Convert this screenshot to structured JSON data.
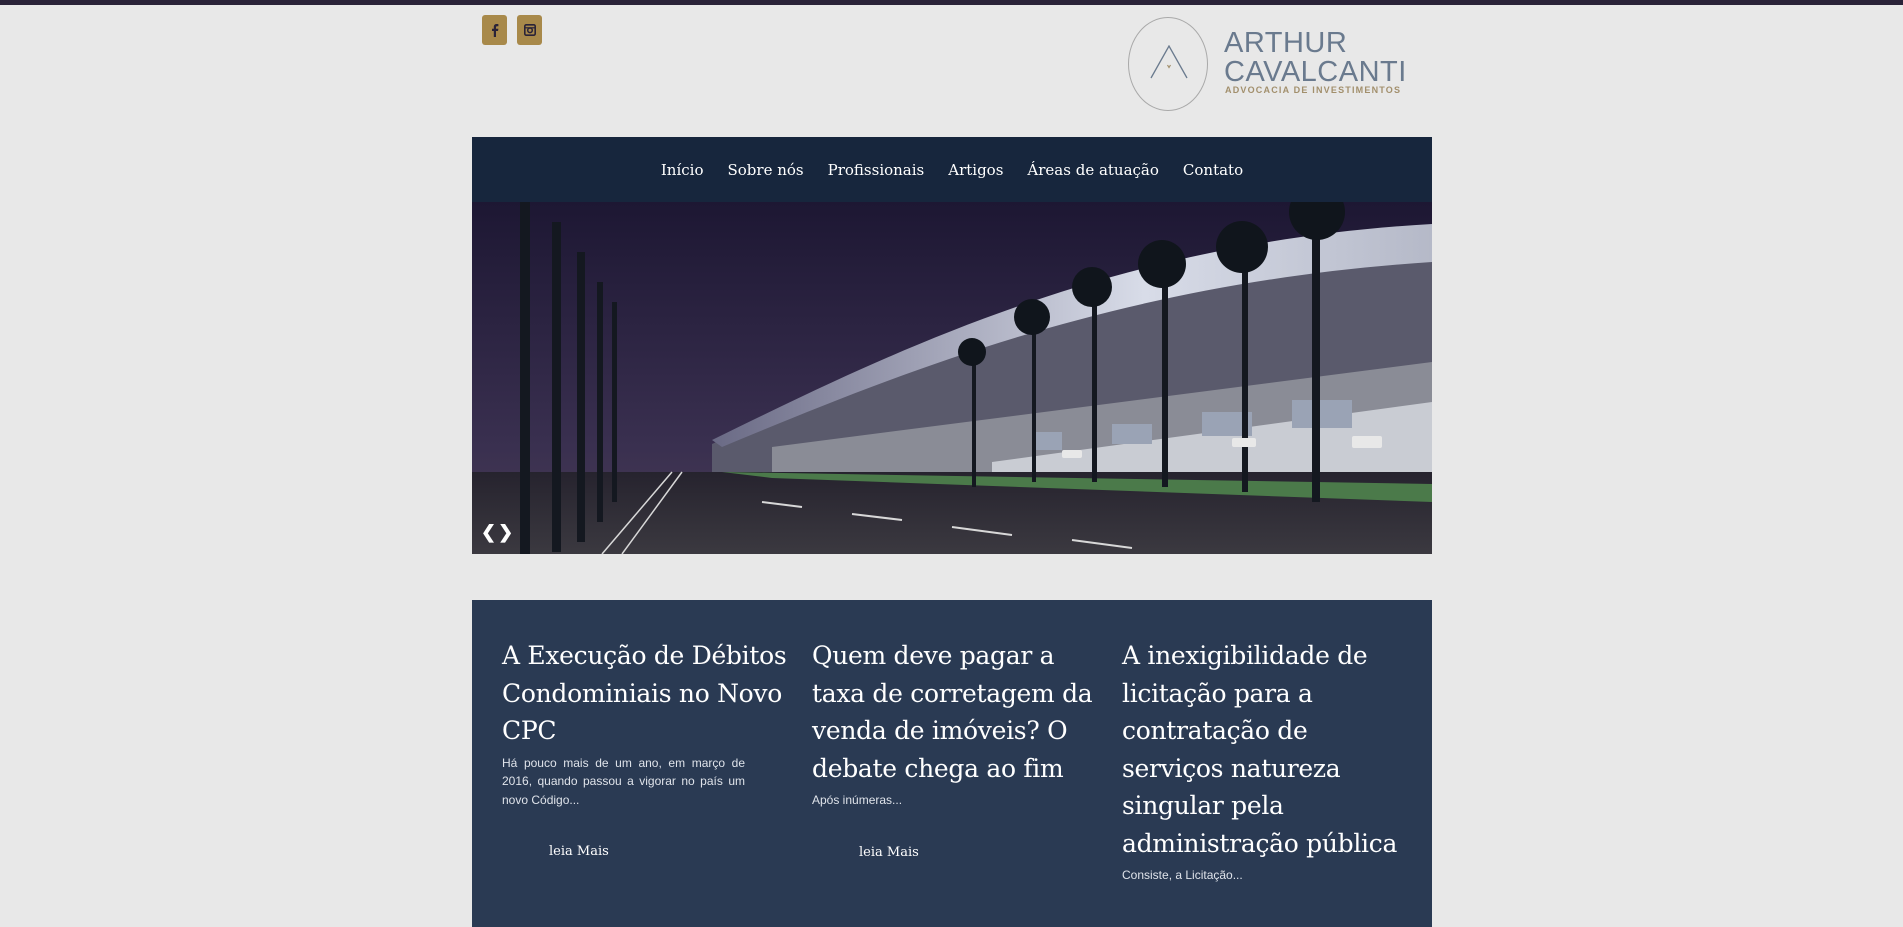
{
  "social": [
    {
      "name": "facebook",
      "icon": "facebook-icon"
    },
    {
      "name": "instagram",
      "icon": "instagram-icon"
    }
  ],
  "logo": {
    "name": "ARTHUR\nCAVALCANTI",
    "tagline": "ADVOCACIA DE INVESTIMENTOS"
  },
  "nav": {
    "items": [
      "Início",
      "Sobre nós",
      "Profissionais",
      "Artigos",
      "Áreas de atuação",
      "Contato"
    ]
  },
  "hero": {
    "prev": "❮",
    "next": "❯"
  },
  "articles": [
    {
      "title": "A Execução de Débitos Condominiais no Novo CPC",
      "excerpt": " Há pouco mais de um ano, em março de 2016, quando passou a vigorar no país um novo Código...",
      "read_more": "leia Mais"
    },
    {
      "title": "Quem deve pagar a taxa de corretagem da venda de imóveis? O debate chega ao fim",
      "excerpt": " Após inúmeras...",
      "read_more": "leia Mais"
    },
    {
      "title": "A inexigibilidade de licitação para a contratação de serviços natureza singular pela administração pública",
      "excerpt": " Consiste, a Licitação...",
      "read_more": ""
    }
  ],
  "colors": {
    "accent": "#a8894a",
    "nav_bg": "#17263d",
    "articles_bg": "#2a3a53",
    "page_bg": "#e8e8e8"
  }
}
